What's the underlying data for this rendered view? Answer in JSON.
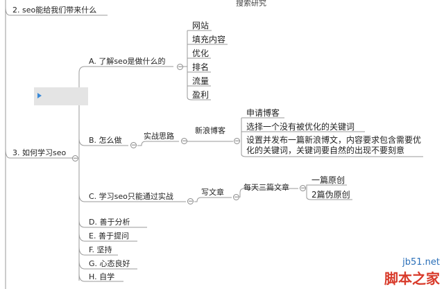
{
  "top_partial": "搜索研究",
  "branches": {
    "b2": "2. seo能给我们带来什么",
    "b3": "3. 如何学习seo"
  },
  "section_a": {
    "label": "A. 了解seo是做什么的",
    "items": [
      "网站",
      "填充内容",
      "优化",
      "排名",
      "流量",
      "盈利"
    ]
  },
  "section_b": {
    "label": "B. 怎么做",
    "sub": "实战思路",
    "subsub": "新浪博客",
    "items": [
      "申请博客",
      "选择一个没有被优化的关键词",
      "设置并发布一篇新浪博文，内容要求包含需要优化的关键词，关键词要自然的出现不要刻意"
    ]
  },
  "section_c": {
    "label": "C. 学习seo只能通过实战",
    "sub": "写文章",
    "subsub": "每天三篇文章",
    "items": [
      "一篇原创",
      "2篇伪原创"
    ]
  },
  "other_sections": [
    "D. 善于分析",
    "E. 善于提问",
    "F. 坚持",
    "G. 心态良好",
    "H. 自学"
  ],
  "toggle_symbol": "−",
  "watermark": {
    "domain": "jb51.net",
    "name": "脚本之家"
  },
  "colors": {
    "line": "#9a9a9a",
    "selection": "#e4e4e4",
    "arrow": "#3a8ad8",
    "watermark_red": "#d83a2a"
  }
}
